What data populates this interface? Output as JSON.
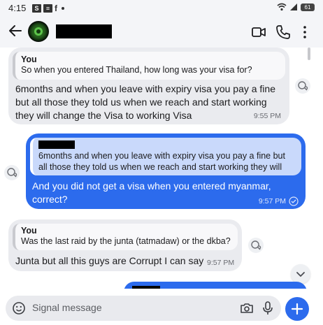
{
  "status_bar": {
    "time": "4:15",
    "battery": "61"
  },
  "header": {
    "contact_name": ""
  },
  "messages": [
    {
      "direction": "incoming",
      "quote_author": "You",
      "quote_text": "So when you entered Thailand, how long was your visa for?",
      "text": "6months and when you leave with expiry visa you pay a fine but all those they told us when we reach and start working they will change the Visa to working Visa",
      "time": "9:55 PM"
    },
    {
      "direction": "outgoing",
      "quote_author": "",
      "quote_text": "6months and when you leave with expiry visa you pay a fine but all those they told us when we reach and start working they will chang...",
      "text": "And you did not get a visa when you entered myanmar, correct?",
      "time": "9:57 PM"
    },
    {
      "direction": "incoming",
      "quote_author": "You",
      "quote_text": "Was the last raid by the junta (tatmadaw) or the dkba?",
      "text": "Junta but all this guys are Corrupt I can say",
      "time": "9:57 PM"
    }
  ],
  "composer": {
    "placeholder": "Signal message"
  },
  "colors": {
    "accent": "#2c6bed",
    "incoming_bubble": "#eaebef"
  },
  "icons": [
    "back-arrow-icon",
    "video-call-icon",
    "phone-icon",
    "more-options-icon",
    "reaction-icon",
    "chevron-down-icon",
    "sticker-icon",
    "camera-icon",
    "microphone-icon",
    "plus-icon"
  ]
}
